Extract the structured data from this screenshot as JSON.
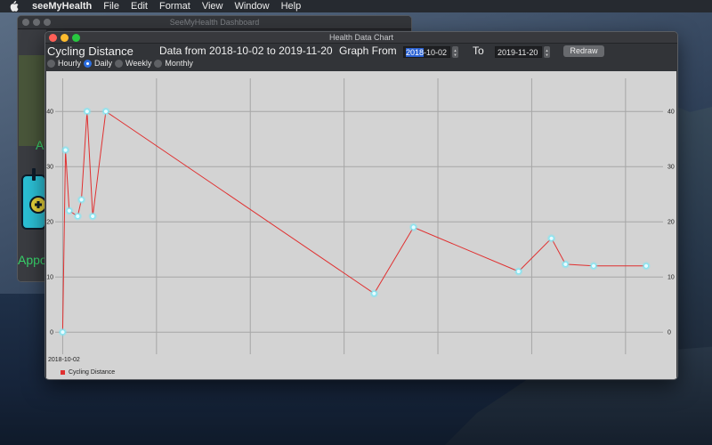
{
  "menubar": {
    "app_name": "seeMyHealth",
    "items": [
      "File",
      "Edit",
      "Format",
      "View",
      "Window",
      "Help"
    ]
  },
  "dashboard": {
    "title": "SeeMyHealth Dashboard",
    "tile_letter": "A",
    "appointments_label": "Appo"
  },
  "window": {
    "title": "Health Data Chart"
  },
  "toolbar": {
    "metric_name": "Cycling Distance",
    "range_label": "Data from 2018-10-02 to 2019-11-20",
    "graph_from_label": "Graph From",
    "from_date_selected": "2018",
    "from_date_rest": "-10-02",
    "to_label": "To",
    "to_date": "2019-11-20",
    "redraw_label": "Redraw"
  },
  "granularity": {
    "options": [
      "Hourly",
      "Daily",
      "Weekly",
      "Monthly"
    ],
    "selected": "Daily"
  },
  "chart_data": {
    "type": "line",
    "x_start_label": "2018-10-02",
    "series": [
      {
        "name": "Cycling Distance",
        "color": "#e03030",
        "points": [
          [
            0,
            0
          ],
          [
            3,
            33
          ],
          [
            7,
            22
          ],
          [
            16,
            21
          ],
          [
            20,
            24
          ],
          [
            26,
            40
          ],
          [
            32,
            21
          ],
          [
            46,
            40
          ],
          [
            332,
            7
          ],
          [
            374,
            19
          ],
          [
            486,
            11
          ],
          [
            521,
            17
          ],
          [
            536,
            12.3
          ],
          [
            566,
            12
          ],
          [
            622,
            12
          ]
        ]
      }
    ],
    "xlim": [
      -8,
      640
    ],
    "ylim": [
      -4,
      46
    ],
    "yticks": [
      0,
      10,
      20,
      30,
      40
    ],
    "grid": true,
    "marker_color": "#7ee6f4",
    "legend_position": "bottom-left"
  }
}
